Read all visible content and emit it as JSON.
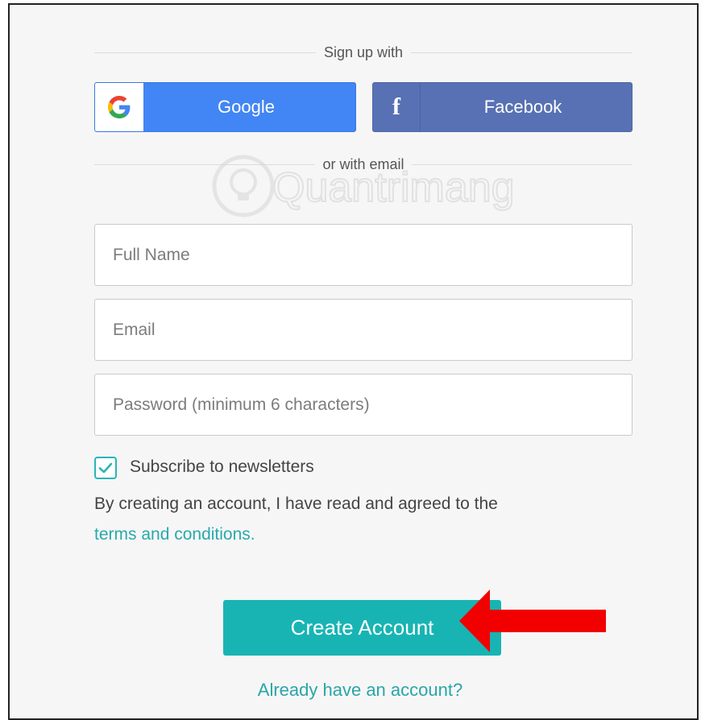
{
  "signup": {
    "social_divider": "Sign up with",
    "google_label": "Google",
    "facebook_label": "Facebook",
    "facebook_icon_glyph": "f",
    "email_divider": "or with email"
  },
  "form": {
    "full_name_placeholder": "Full Name",
    "email_placeholder": "Email",
    "password_placeholder": "Password (minimum 6 characters)"
  },
  "newsletter": {
    "label": "Subscribe to newsletters",
    "checked": true
  },
  "terms": {
    "text": "By creating an account, I have read and agreed to the",
    "link": "terms and conditions."
  },
  "create_button_label": "Create Account",
  "login_link": "Already have an account?",
  "watermark": {
    "text": "Quantrimang",
    "icon": "lightbulb-icon"
  },
  "annotation": {
    "icon": "red-arrow-icon",
    "color": "#f20000"
  },
  "colors": {
    "google": "#4285f4",
    "facebook": "#5771b4",
    "accent": "#18b4b4",
    "link": "#29a9ad"
  }
}
